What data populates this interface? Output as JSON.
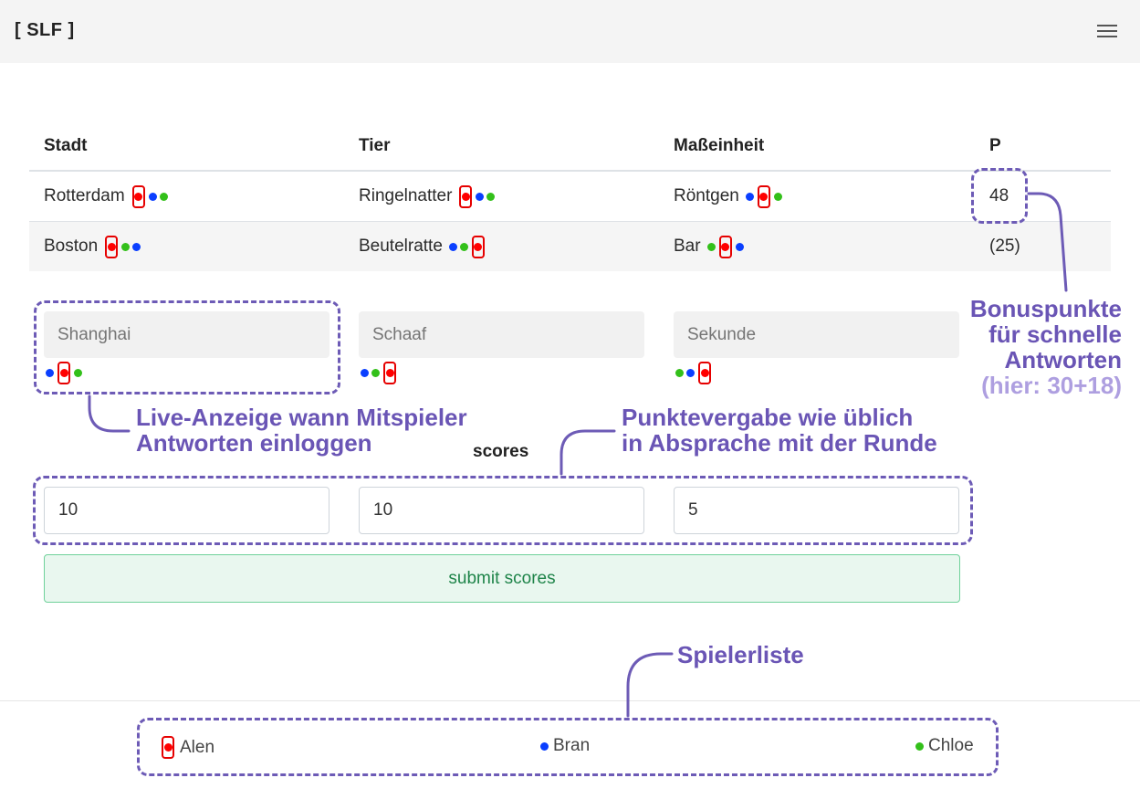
{
  "header": {
    "brand": "[ SLF ]"
  },
  "table": {
    "headers": [
      "Stadt",
      "Tier",
      "Maßeinheit",
      "P"
    ],
    "rows": [
      {
        "cells": [
          "Rotterdam",
          "Ringelnatter",
          "Röntgen"
        ],
        "points": "48"
      },
      {
        "cells": [
          "Boston",
          "Beutelratte",
          "Bar"
        ],
        "points": "(25)"
      }
    ]
  },
  "answers": {
    "placeholders": [
      "Shanghai",
      "Schaaf",
      "Sekunde"
    ]
  },
  "scores": {
    "title": "scores",
    "values": [
      "10",
      "10",
      "5"
    ],
    "submit_label": "submit scores"
  },
  "players": [
    "Alen",
    "Bran",
    "Chloe"
  ],
  "annotations": {
    "bonus": [
      "Bonuspunkte",
      "für schnelle",
      "Antworten"
    ],
    "bonus_sub": "(hier: 30+18)",
    "live": [
      "Live-Anzeige wann Mitspieler",
      "Antworten einloggen"
    ],
    "points": [
      "Punktevergabe wie üblich",
      "in Absprache mit der Runde"
    ],
    "players": "Spielerliste"
  },
  "colors": {
    "player_red": "#ff0000",
    "player_blue": "#0a3fff",
    "player_green": "#33c01a",
    "annotation": "#6d5bb6",
    "annotation_sub": "#ae9fe0",
    "submit_border": "#6fd19a"
  }
}
